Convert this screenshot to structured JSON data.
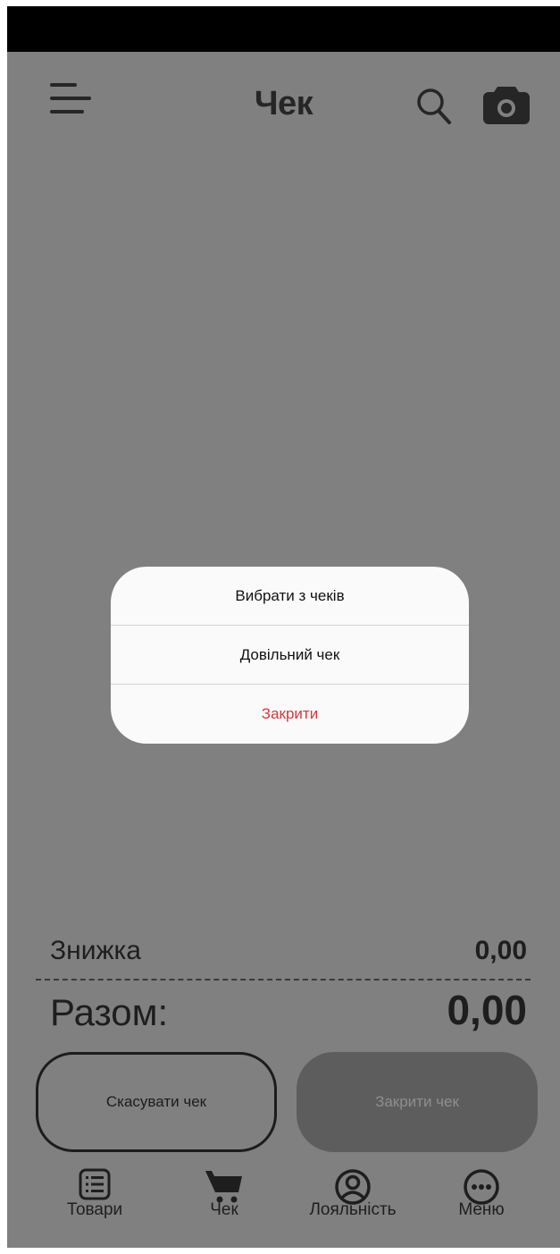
{
  "header": {
    "title": "Чек",
    "menu_icon": "hamburger-menu-icon",
    "search_icon": "search-icon",
    "camera_icon": "camera-icon"
  },
  "dialog": {
    "items": [
      {
        "label": "Вибрати з чеків"
      },
      {
        "label": "Довільний чек"
      },
      {
        "label": "Закрити"
      }
    ]
  },
  "totals": {
    "discount_label": "Знижка",
    "discount_value": "0,00",
    "total_label": "Разом:",
    "total_value": "0,00"
  },
  "actions": {
    "cancel_label": "Скасувати чек",
    "close_label": "Закрити чек"
  },
  "nav": {
    "items": [
      {
        "label": "Товари",
        "icon": "list-icon"
      },
      {
        "label": "Чек",
        "icon": "cart-icon"
      },
      {
        "label": "Лояльність",
        "icon": "user-circle-icon"
      },
      {
        "label": "Меню",
        "icon": "more-icon"
      }
    ]
  },
  "colors": {
    "overlay": "#808080",
    "dialog_bg": "#fafafa",
    "close_text": "#d9363e",
    "disabled_button": "#5d5d5d"
  }
}
